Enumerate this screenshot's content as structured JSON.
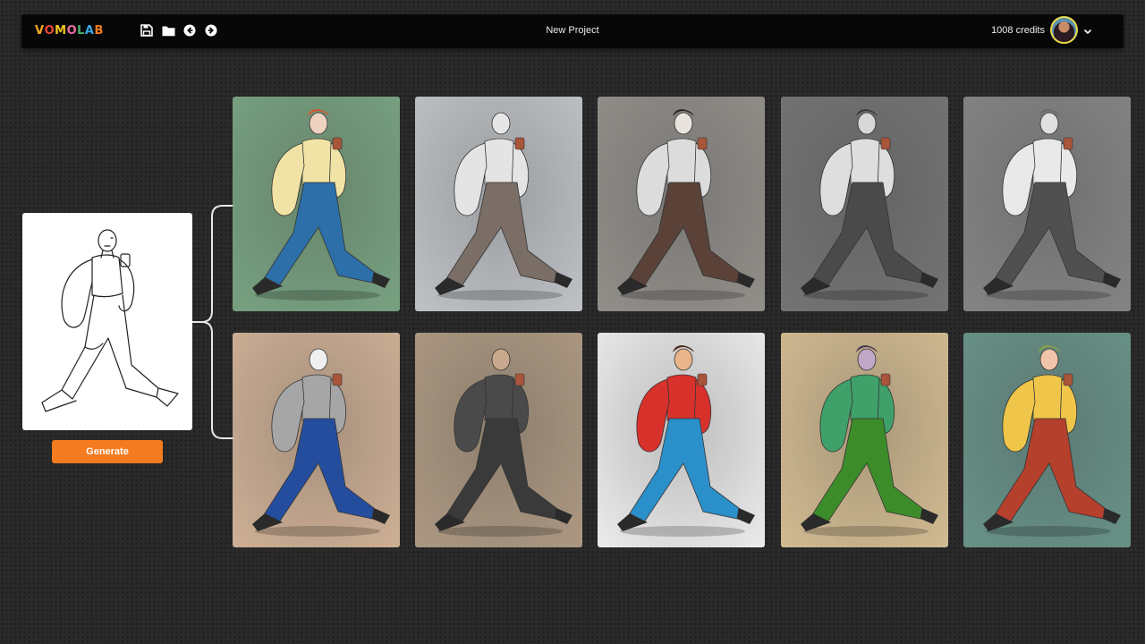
{
  "header": {
    "logo_letters": [
      {
        "char": "V",
        "color": "#f7a824"
      },
      {
        "char": "O",
        "color": "#e8473b"
      },
      {
        "char": "M",
        "color": "#f3c623"
      },
      {
        "char": "O",
        "color": "#e96fa3"
      },
      {
        "char": "L",
        "color": "#4caf6d"
      },
      {
        "char": "A",
        "color": "#3aa7e0"
      },
      {
        "char": "B",
        "color": "#f47b20"
      }
    ],
    "toolbar_icons": [
      "save-icon",
      "folder-icon",
      "undo-icon",
      "redo-icon"
    ],
    "project_title": "New Project",
    "credits": "1008 credits"
  },
  "source": {
    "generate_label": "Generate"
  },
  "results": [
    {
      "name": "result-green-redhead",
      "bg": "#6f9a78",
      "shirt": "#f1e3a5",
      "pants": "#2d6fa8",
      "head": "#f0d2c0",
      "hair": "#d9542a"
    },
    {
      "name": "result-grey-mannequin",
      "bg": "#b9bcc0",
      "shirt": "#e4e4e4",
      "pants": "#7b6e66",
      "head": "#e6e6e6",
      "hair": "none"
    },
    {
      "name": "result-brown-bearded",
      "bg": "#8a8782",
      "shirt": "#dcdcdc",
      "pants": "#5a4238",
      "head": "#e8e3dd",
      "hair": "#2a2a2a"
    },
    {
      "name": "result-sketch-longhair",
      "bg": "#6b6b6b",
      "shirt": "#dedede",
      "pants": "#4a4a4a",
      "head": "#d8d8d8",
      "hair": "#3a3a3a"
    },
    {
      "name": "result-grey-bearded",
      "bg": "#7c7c7c",
      "shirt": "#e9e9e9",
      "pants": "#505050",
      "head": "#e0e0e0",
      "hair": "#6a6a6a"
    },
    {
      "name": "result-tan-blue",
      "bg": "#c9a98e",
      "shirt": "#a6a6a6",
      "pants": "#244d9e",
      "head": "#efefef",
      "hair": "none"
    },
    {
      "name": "result-dark-trees",
      "bg": "#a6917a",
      "shirt": "#4a4a4a",
      "pants": "#3a3a3a",
      "head": "#c9a98e",
      "hair": "none"
    },
    {
      "name": "result-pattern-red",
      "bg": "#e8e8e8",
      "shirt": "#d8312b",
      "pants": "#2b8fc9",
      "head": "#e8b48a",
      "hair": "#4a2a1a"
    },
    {
      "name": "result-green-purple",
      "bg": "#cdb58a",
      "shirt": "#3fa06a",
      "pants": "#3d8c2a",
      "head": "#c0a7c6",
      "hair": "#4a3a5a"
    },
    {
      "name": "result-teal-camera",
      "bg": "#5f8a80",
      "shirt": "#f0c64a",
      "pants": "#b5402c",
      "head": "#f0c4a8",
      "hair": "#8aa040"
    }
  ]
}
